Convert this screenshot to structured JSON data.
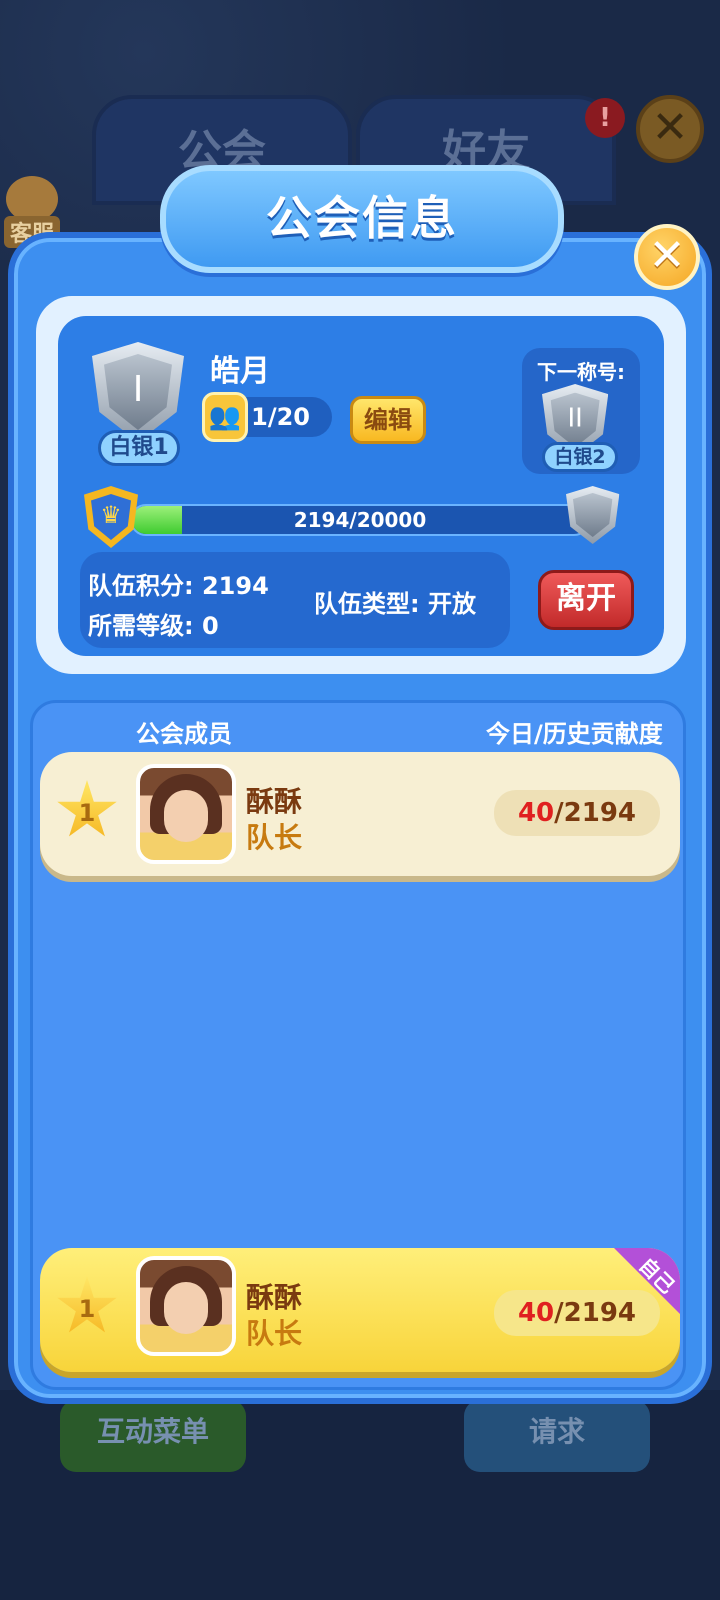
{
  "background": {
    "tabs": [
      "公会",
      "好友"
    ],
    "alert": "!",
    "close": "✕",
    "customer_service": "客服",
    "bottom_buttons": [
      "互动菜单",
      "请求"
    ]
  },
  "dialog": {
    "title": "公会信息",
    "close": "✕"
  },
  "guild": {
    "name": "皓月",
    "rank_badge": "白银1",
    "rank_numeral": "I",
    "members": "1/20",
    "edit_label": "编辑",
    "next_title_label": "下一称号:",
    "next_rank_badge": "白银2",
    "next_rank_numeral": "II",
    "progress_text": "2194/20000",
    "progress_fraction": 0.1097,
    "team_score_label": "队伍积分:",
    "team_score": "2194",
    "required_level_label": "所需等级:",
    "required_level": "0",
    "team_type_label": "队伍类型:",
    "team_type": "开放",
    "leave_label": "离开"
  },
  "members_list": {
    "header_left": "公会成员",
    "header_right": "今日/历史贡献度",
    "rows": [
      {
        "rank": "1",
        "name": "酥酥",
        "role": "队长",
        "today": "40",
        "total": "/2194"
      }
    ],
    "self": {
      "rank": "1",
      "name": "酥酥",
      "role": "队长",
      "today": "40",
      "total": "/2194",
      "tag": "自己"
    }
  },
  "colors": {
    "panel": "#3d8ff0",
    "leave": "#c22a2a",
    "edit": "#f8b821",
    "today_score": "#e02020"
  }
}
